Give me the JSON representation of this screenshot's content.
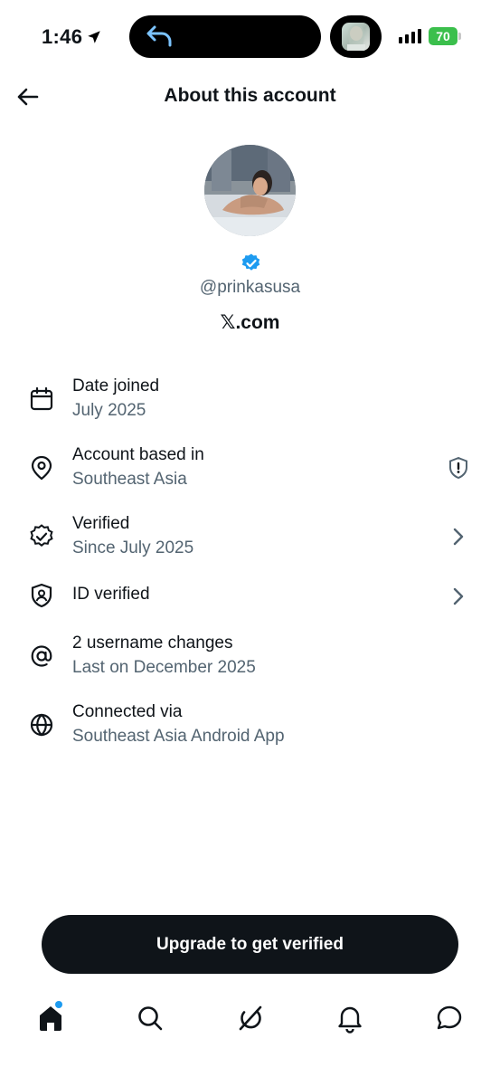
{
  "status_bar": {
    "time": "1:46",
    "battery": "70",
    "icons": [
      "location-arrow-icon",
      "back-arrow-icon",
      "signal-icon",
      "battery-icon"
    ]
  },
  "header": {
    "title": "About this account",
    "back_icon": "arrow-left-icon"
  },
  "profile": {
    "handle": "@prinkasusa",
    "site": "𝕏.com",
    "verified_color": "#1d9bf0"
  },
  "info_rows": [
    {
      "icon": "calendar-icon",
      "primary": "Date joined",
      "secondary": "July 2025",
      "right_icon": ""
    },
    {
      "icon": "location-pin-icon",
      "primary": "Account based in",
      "secondary": "Southeast Asia",
      "right_icon": "shield-alert-icon"
    },
    {
      "icon": "verified-badge-icon",
      "primary": "Verified",
      "secondary": "Since July 2025",
      "right_icon": "chevron-right-icon"
    },
    {
      "icon": "id-shield-icon",
      "primary": "ID verified",
      "secondary": "",
      "right_icon": "chevron-right-icon"
    },
    {
      "icon": "at-sign-icon",
      "primary": "2 username changes",
      "secondary": "Last on December 2025",
      "right_icon": ""
    },
    {
      "icon": "globe-icon",
      "primary": "Connected via",
      "secondary": "Southeast Asia Android App",
      "right_icon": ""
    }
  ],
  "upgrade_button": {
    "label": "Upgrade to get verified",
    "bg_color": "#0f1419"
  },
  "bottom_nav": {
    "items": [
      "home-icon",
      "search-icon",
      "grok-icon",
      "bell-icon",
      "chat-icon"
    ],
    "notification_color": "#1d9bf0"
  },
  "colors": {
    "text_primary": "#0f1419",
    "text_secondary": "#536471",
    "accent": "#1d9bf0"
  }
}
